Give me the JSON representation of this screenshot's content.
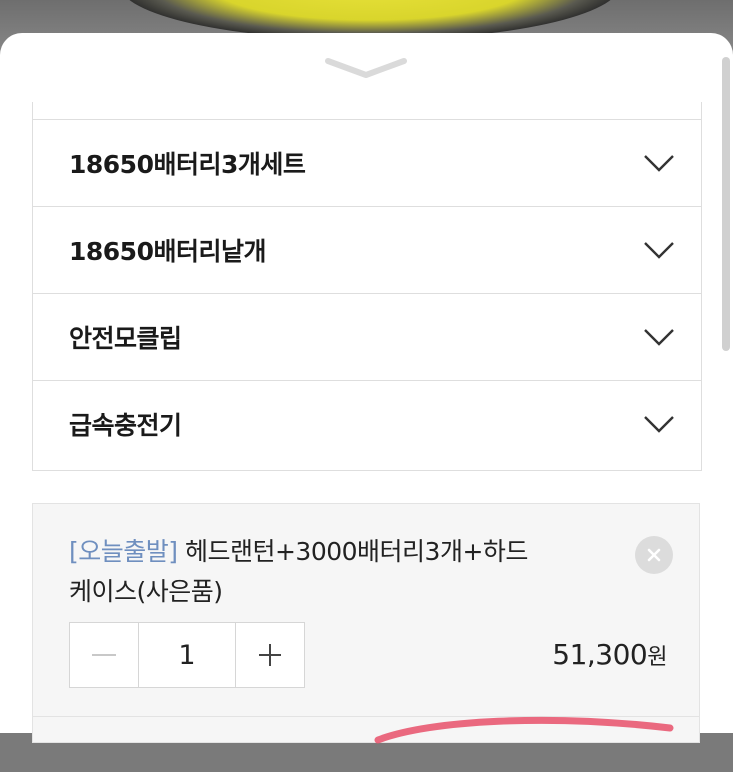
{
  "options": {
    "items": [
      {
        "label": "18650배터리3개세트"
      },
      {
        "label": "18650배터리낱개"
      },
      {
        "label": "안전모클립"
      },
      {
        "label": "급속충전기"
      }
    ]
  },
  "selected": {
    "tag": "[오늘출발]",
    "title_line1": " 헤드랜턴+3000배터리3개+하드",
    "title_line2": "케이스(사은품)",
    "quantity": "1",
    "price": "51,300",
    "currency": "원",
    "decrement_icon": "minus-icon",
    "increment_icon": "plus-icon",
    "remove_icon": "close-icon"
  },
  "colors": {
    "tag": "#6f8fbf",
    "annotation": "#e8506a"
  }
}
